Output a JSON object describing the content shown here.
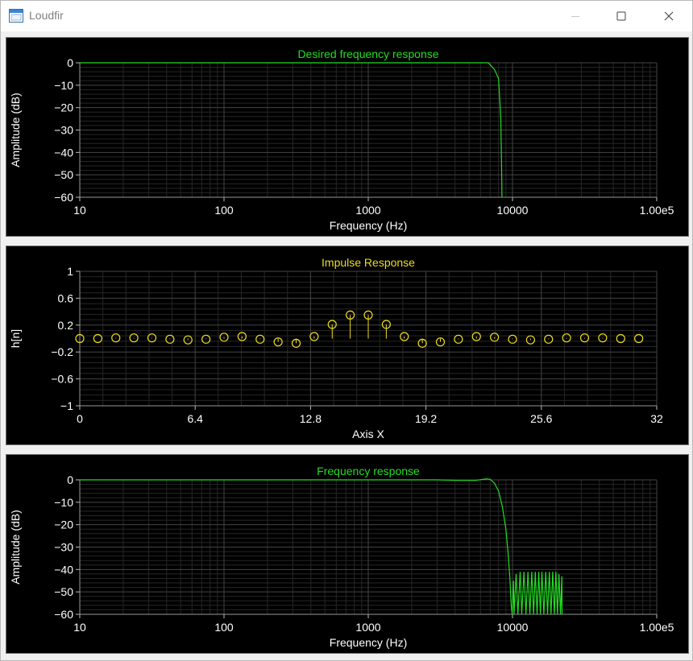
{
  "window": {
    "title": "Loudfir",
    "icon": "window-app-icon",
    "buttons": [
      "minimize",
      "maximize",
      "close"
    ]
  },
  "colors": {
    "chart_bg": "#000000",
    "grid_major": "#444444",
    "grid_minor": "#262626",
    "axis_text": "#ffffff",
    "green": "#22dd22",
    "yellow": "#eedd22"
  },
  "chart_data": [
    {
      "type": "line",
      "title": "Desired frequency response",
      "xlabel": "Frequency (Hz)",
      "ylabel": "Amplitude (dB)",
      "xscale": "log",
      "xlim": [
        10,
        100000
      ],
      "ylim": [
        -60,
        0
      ],
      "xticks": [
        "10",
        "100",
        "1000",
        "10000",
        "1.00e5"
      ],
      "yticks": [
        "0",
        "−10",
        "−20",
        "−30",
        "−40",
        "−50",
        "−60"
      ],
      "grid": true,
      "series": [
        {
          "color": "#22dd22",
          "x": [
            10,
            6800,
            7500,
            8000,
            8300,
            8400,
            8450
          ],
          "y": [
            0,
            0,
            -3,
            -7,
            -25,
            -45,
            -60
          ]
        }
      ]
    },
    {
      "type": "scatter",
      "subtype": "stem",
      "title": "Impulse Response",
      "xlabel": "Axis X",
      "ylabel": "h[n]",
      "xlim": [
        0,
        32
      ],
      "ylim": [
        -1,
        1
      ],
      "xticks": [
        "0",
        "6.4",
        "12.8",
        "19.2",
        "25.6",
        "32"
      ],
      "yticks": [
        "1",
        "0.6",
        "0.2",
        "−0.2",
        "−0.6",
        "−1"
      ],
      "grid": true,
      "series": [
        {
          "color": "#eedd22",
          "x": [
            0,
            1,
            2,
            3,
            4,
            5,
            6,
            7,
            8,
            9,
            10,
            11,
            12,
            13,
            14,
            15,
            16,
            17,
            18,
            19,
            20,
            21,
            22,
            23,
            24,
            25,
            26,
            27,
            28,
            29,
            30,
            31
          ],
          "y": [
            0.0,
            0.0,
            0.01,
            0.01,
            0.01,
            -0.01,
            -0.02,
            -0.01,
            0.02,
            0.03,
            -0.01,
            -0.05,
            -0.07,
            0.03,
            0.21,
            0.35,
            0.35,
            0.21,
            0.03,
            -0.07,
            -0.05,
            -0.01,
            0.03,
            0.02,
            -0.01,
            -0.02,
            -0.01,
            0.01,
            0.01,
            0.01,
            0.0,
            0.0
          ]
        }
      ]
    },
    {
      "type": "line",
      "title": "Frequency response",
      "xlabel": "Frequency (Hz)",
      "ylabel": "Amplitude (dB)",
      "xscale": "log",
      "xlim": [
        10,
        100000
      ],
      "ylim": [
        -60,
        0
      ],
      "xticks": [
        "10",
        "100",
        "1000",
        "10000",
        "1.00e5"
      ],
      "yticks": [
        "0",
        "−10",
        "−20",
        "−30",
        "−40",
        "−50",
        "−60"
      ],
      "grid": true,
      "series": [
        {
          "color": "#22dd22",
          "x": [
            10,
            100,
            1000,
            3000,
            4500,
            5500,
            6500,
            7000,
            7500,
            8000,
            8500,
            9000,
            9300,
            9600,
            9800,
            9950,
            10150,
            10250,
            10600,
            10900,
            11300,
            11600,
            12000,
            12400,
            12800,
            13200,
            13600,
            14000,
            14400,
            14800,
            15200,
            15600,
            16000,
            16500,
            17000,
            17500,
            18000,
            18500,
            19000,
            19500,
            20000,
            20500,
            21000,
            21500,
            22000,
            22050
          ],
          "y": [
            0,
            0,
            0,
            0,
            -0.3,
            -0.3,
            0.4,
            0.3,
            -1.5,
            -5,
            -12,
            -22,
            -32,
            -44,
            -56,
            -60,
            -45,
            -60,
            -42,
            -60,
            -41,
            -60,
            -41,
            -60,
            -41,
            -60,
            -41,
            -60,
            -41,
            -60,
            -41,
            -60,
            -41,
            -60,
            -41,
            -60,
            -41,
            -60,
            -41,
            -60,
            -41,
            -60,
            -42,
            -60,
            -43,
            -60
          ]
        }
      ]
    }
  ]
}
